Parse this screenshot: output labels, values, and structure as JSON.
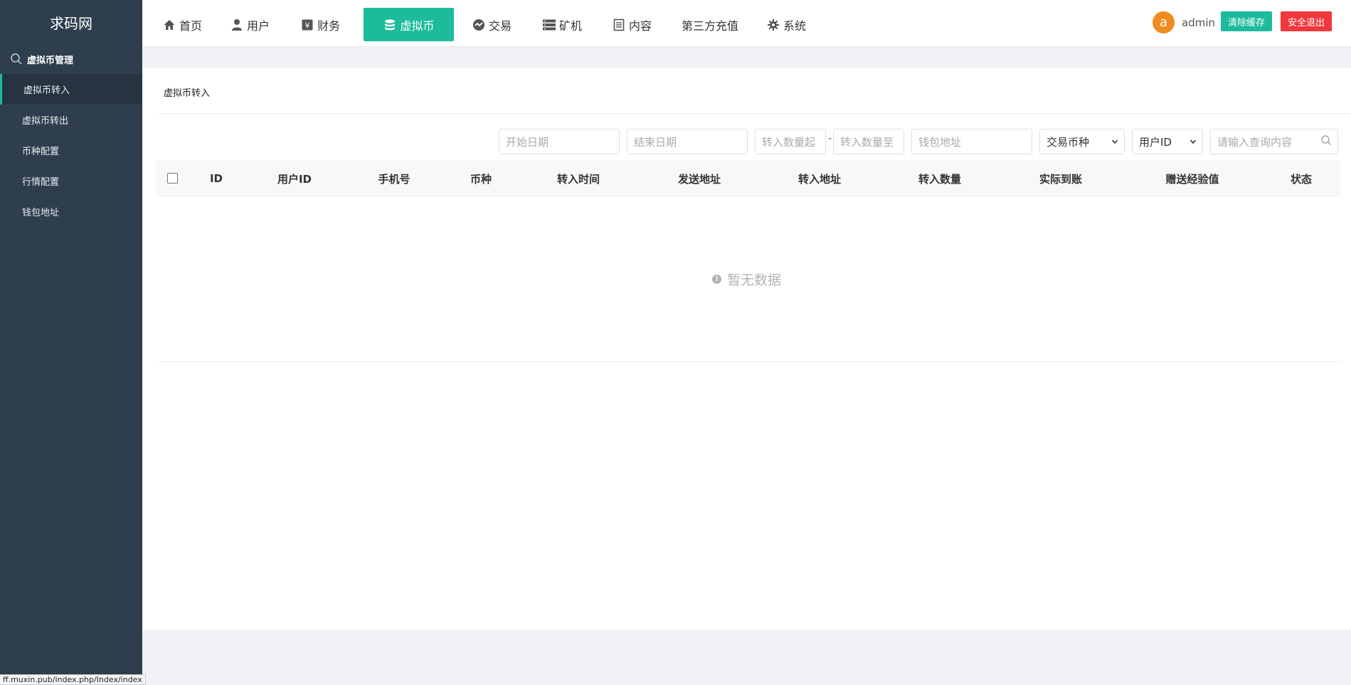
{
  "app": {
    "brand": "求码网"
  },
  "sidebar": {
    "section_label": "虚拟币管理",
    "items": [
      {
        "label": "虚拟币转入"
      },
      {
        "label": "虚拟币转出"
      },
      {
        "label": "币种配置"
      },
      {
        "label": "行情配置"
      },
      {
        "label": "钱包地址"
      }
    ]
  },
  "nav": {
    "items": [
      {
        "label": "首页",
        "icon": "home-icon"
      },
      {
        "label": "用户",
        "icon": "user-icon"
      },
      {
        "label": "财务",
        "icon": "yen-icon"
      },
      {
        "label": "虚拟币",
        "icon": "database-icon"
      },
      {
        "label": "交易",
        "icon": "exchange-icon"
      },
      {
        "label": "矿机",
        "icon": "server-icon"
      },
      {
        "label": "内容",
        "icon": "document-icon"
      },
      {
        "label": "第三方充值"
      },
      {
        "label": "系统",
        "icon": "gear-icon"
      }
    ],
    "active": "虚拟币"
  },
  "user": {
    "avatar_letter": "a",
    "name": "admin",
    "clear_cache_label": "清除缓存",
    "logout_label": "安全退出"
  },
  "colors": {
    "accent": "#1cbb9b",
    "danger": "#f0383d",
    "sidebar": "#2f3e4e",
    "avatar": "#f08c1e"
  },
  "page": {
    "title": "虚拟币转入"
  },
  "filters": {
    "start_date_placeholder": "开始日期",
    "end_date_placeholder": "结束日期",
    "amount_from_placeholder": "转入数量起",
    "amount_sep": "-",
    "amount_to_placeholder": "转入数量至",
    "wallet_placeholder": "钱包地址",
    "coin_select_value": "交易币种",
    "field_select_value": "用户ID",
    "search_placeholder": "请输入查询内容"
  },
  "table": {
    "columns": [
      "ID",
      "用户ID",
      "手机号",
      "币种",
      "转入时间",
      "发送地址",
      "转入地址",
      "转入数量",
      "实际到账",
      "赠送经验值",
      "状态"
    ],
    "rows": [],
    "empty_text": "暂无数据"
  },
  "statusbar": {
    "url": "ff.muxin.pub/index.php/Index/index"
  }
}
